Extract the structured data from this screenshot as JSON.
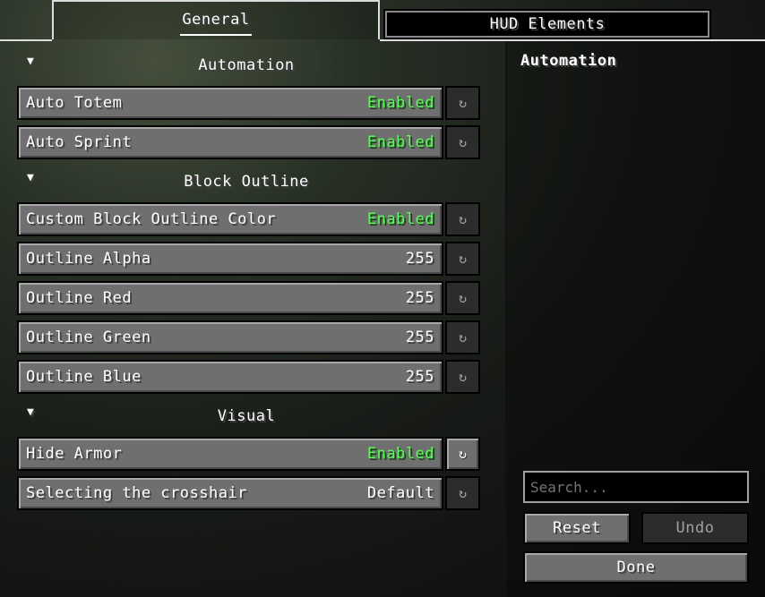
{
  "tabs": [
    {
      "label": "General",
      "active": true
    },
    {
      "label": "HUD Elements",
      "active": false
    }
  ],
  "categories": [
    {
      "title": "Automation",
      "expanded": true
    },
    {
      "title": "Block Outline",
      "expanded": true
    },
    {
      "title": "Visual",
      "expanded": true
    }
  ],
  "options": [
    {
      "label": "Auto Totem",
      "value": "Enabled",
      "enabled": true
    },
    {
      "label": "Auto Sprint",
      "value": "Enabled",
      "enabled": true
    },
    {
      "label": "Custom Block Outline Color",
      "value": "Enabled",
      "enabled": true
    },
    {
      "label": "Outline Alpha",
      "value": "255"
    },
    {
      "label": "Outline Red",
      "value": "255"
    },
    {
      "label": "Outline Green",
      "value": "255"
    },
    {
      "label": "Outline Blue",
      "value": "255"
    },
    {
      "label": "Hide Armor",
      "value": "Enabled",
      "enabled": true
    },
    {
      "label": "Selecting the crosshair",
      "value": "Default"
    }
  ],
  "reset_icon": "refresh-icon",
  "collapse_icon": "triangle-down-icon",
  "side_panel": {
    "title": "Automation",
    "search_placeholder": "Search...",
    "reset_label": "Reset",
    "undo_label": "Undo",
    "done_label": "Done"
  },
  "colors": {
    "enabled_value": "#55ff55",
    "text": "#ffffff"
  }
}
